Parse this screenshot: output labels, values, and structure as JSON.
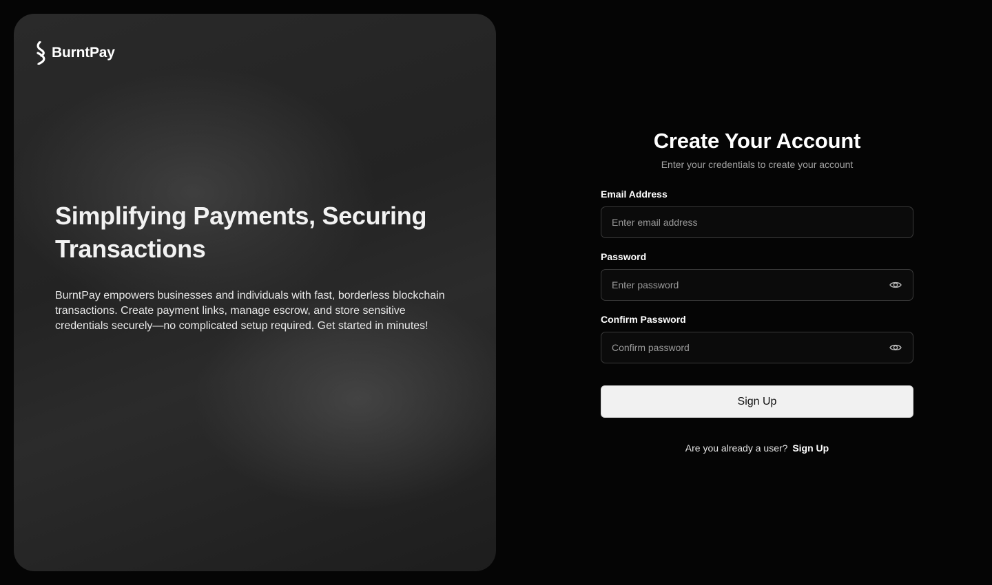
{
  "brand": {
    "name": "BurntPay"
  },
  "hero": {
    "heading": "Simplifying Payments, Securing Transactions",
    "description": "BurntPay empowers businesses and individuals with fast, borderless blockchain transactions. Create payment links, manage escrow, and store sensitive credentials securely—no complicated setup required. Get started in minutes!"
  },
  "form": {
    "title": "Create Your Account",
    "subtitle": "Enter your credentials to create your account",
    "email": {
      "label": "Email Address",
      "placeholder": "Enter email address",
      "value": ""
    },
    "password": {
      "label": "Password",
      "placeholder": "Enter password",
      "value": ""
    },
    "confirm_password": {
      "label": "Confirm Password",
      "placeholder": "Confirm password",
      "value": ""
    },
    "submit_label": "Sign Up",
    "existing_user_prompt": "Are you already a user?",
    "existing_user_link": "Sign Up"
  },
  "icons": {
    "logo": "burntpay-logo-icon",
    "password_toggle": "eye-icon"
  },
  "colors": {
    "background": "#050505",
    "panel": "#262626",
    "button": "#f1f1f1",
    "input_border": "#3a3a3a"
  }
}
